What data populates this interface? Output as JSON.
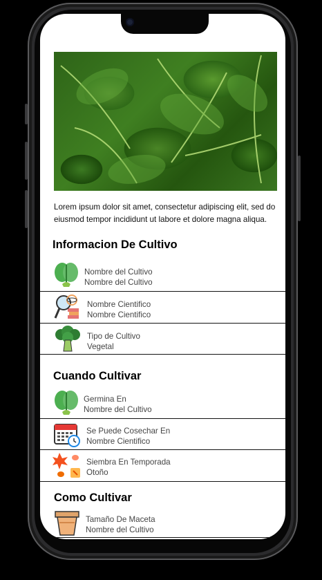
{
  "intro_text": "Lorem ipsum dolor sit amet, consectetur adipiscing elit, sed do eiusmod tempor  incididunt ut labore et dolore magna aliqua.",
  "sections": [
    {
      "title": "Informacion De Cultivo",
      "rows": [
        {
          "label": "Nombre del Cultivo",
          "value": "Nombre del Cultivo",
          "icon": "spinach-icon"
        },
        {
          "label": "Nombre Cientifico",
          "value": "Nombre Cientifico",
          "icon": "lab-magnifier-icon"
        },
        {
          "label": "Tipo de Cultivo",
          "value": "Vegetal",
          "icon": "broccoli-icon"
        }
      ]
    },
    {
      "title": "Cuando Cultivar",
      "rows": [
        {
          "label": "Germina En",
          "value": "Nombre del Cultivo",
          "icon": "spinach-icon"
        },
        {
          "label": "Se Puede Cosechar En",
          "value": "Nombre Cientifico",
          "icon": "calendar-clock-icon"
        },
        {
          "label": "Siembra En Temporada",
          "value": "Otoño",
          "icon": "autumn-leaves-icon"
        }
      ]
    },
    {
      "title": "Como Cultivar",
      "rows": [
        {
          "label": "Tamaño De Maceta",
          "value": "Nombre del Cultivo",
          "icon": "flower-pot-icon"
        }
      ]
    }
  ],
  "colors": {
    "screen_bg": "#ffffff",
    "divider": "#111111",
    "text_secondary": "#444444",
    "leaf_green": "#4caf50"
  }
}
